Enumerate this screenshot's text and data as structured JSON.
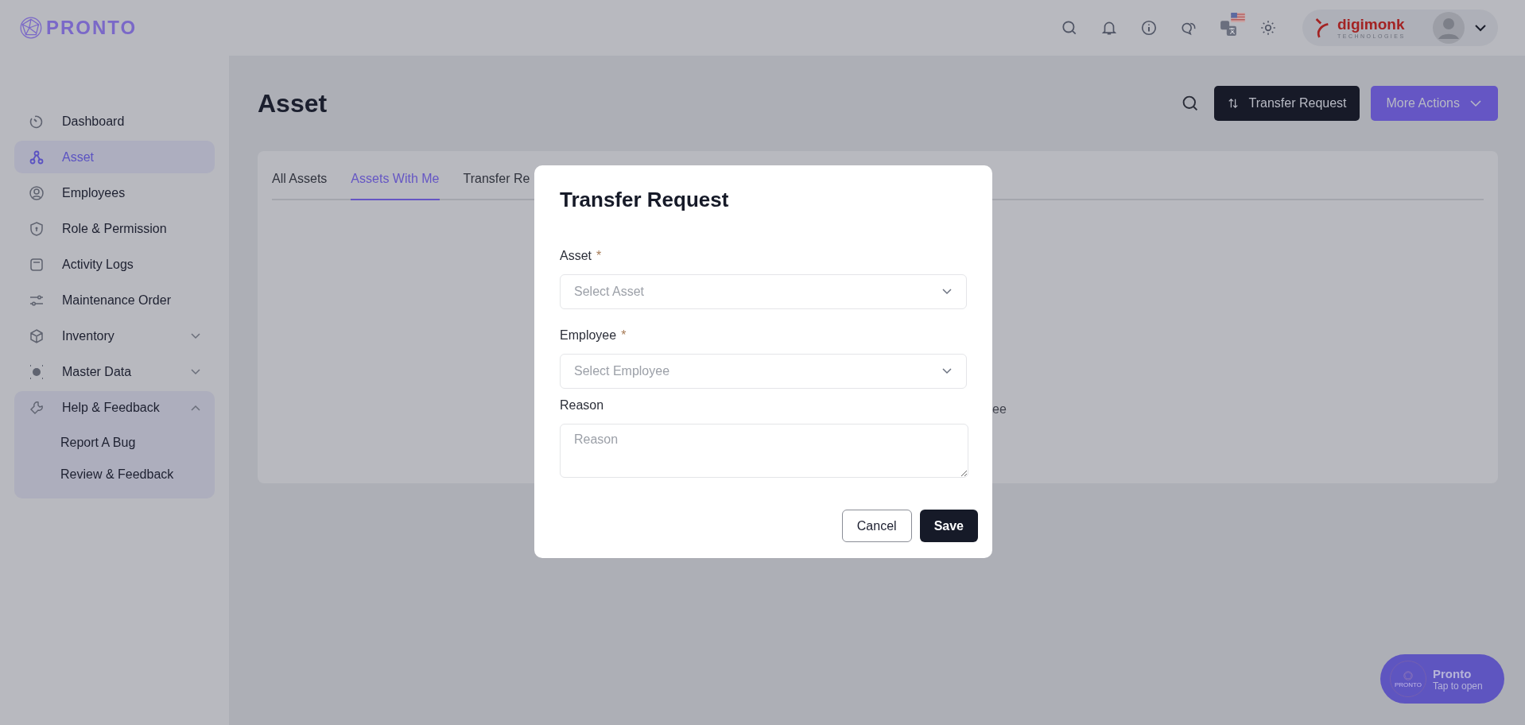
{
  "logo": {
    "text": "PRONTO"
  },
  "header": {
    "brand": {
      "name": "digimonk",
      "tagline": "TECHNOLOGIES"
    }
  },
  "sidebar": {
    "items": [
      {
        "label": "Dashboard",
        "kind": "link",
        "selected": false
      },
      {
        "label": "Asset",
        "kind": "link",
        "selected": true
      },
      {
        "label": "Employees",
        "kind": "link",
        "selected": false
      },
      {
        "label": "Role & Permission",
        "kind": "link",
        "selected": false
      },
      {
        "label": "Activity Logs",
        "kind": "link",
        "selected": false
      },
      {
        "label": "Maintenance Order",
        "kind": "link",
        "selected": false
      },
      {
        "label": "Inventory",
        "kind": "group",
        "selected": false,
        "expanded": false
      },
      {
        "label": "Master Data",
        "kind": "group",
        "selected": false,
        "expanded": false
      },
      {
        "label": "Help & Feedback",
        "kind": "group",
        "selected": false,
        "expanded": true,
        "children": [
          {
            "label": "Report A Bug"
          },
          {
            "label": "Review & Feedback"
          }
        ]
      }
    ]
  },
  "page": {
    "title": "Asset",
    "actions": [
      {
        "label": "Transfer Request",
        "kind": "dark"
      },
      {
        "label": "More Actions",
        "kind": "primary"
      }
    ]
  },
  "tabs": [
    {
      "label": "All Assets",
      "selected": false
    },
    {
      "label": "Assets With Me",
      "selected": true
    },
    {
      "label": "Transfer Re",
      "selected": false
    }
  ],
  "card": {
    "text_fragment": "ee"
  },
  "dialog": {
    "title": "Transfer Request",
    "fields": [
      {
        "label": "Asset",
        "required_mark": "*",
        "kind": "select",
        "placeholder": "Select Asset"
      },
      {
        "label": "Employee",
        "required_mark": "*",
        "kind": "select",
        "placeholder": "Select Employee"
      },
      {
        "label": "Reason",
        "kind": "textarea",
        "placeholder": "Reason"
      }
    ],
    "buttons": [
      {
        "label": "Cancel",
        "kind": "secondary"
      },
      {
        "label": "Save",
        "kind": "primary"
      }
    ]
  },
  "assistant": {
    "name": "Pronto",
    "hint": "Tap to open",
    "logo_text": "PRONTO"
  }
}
